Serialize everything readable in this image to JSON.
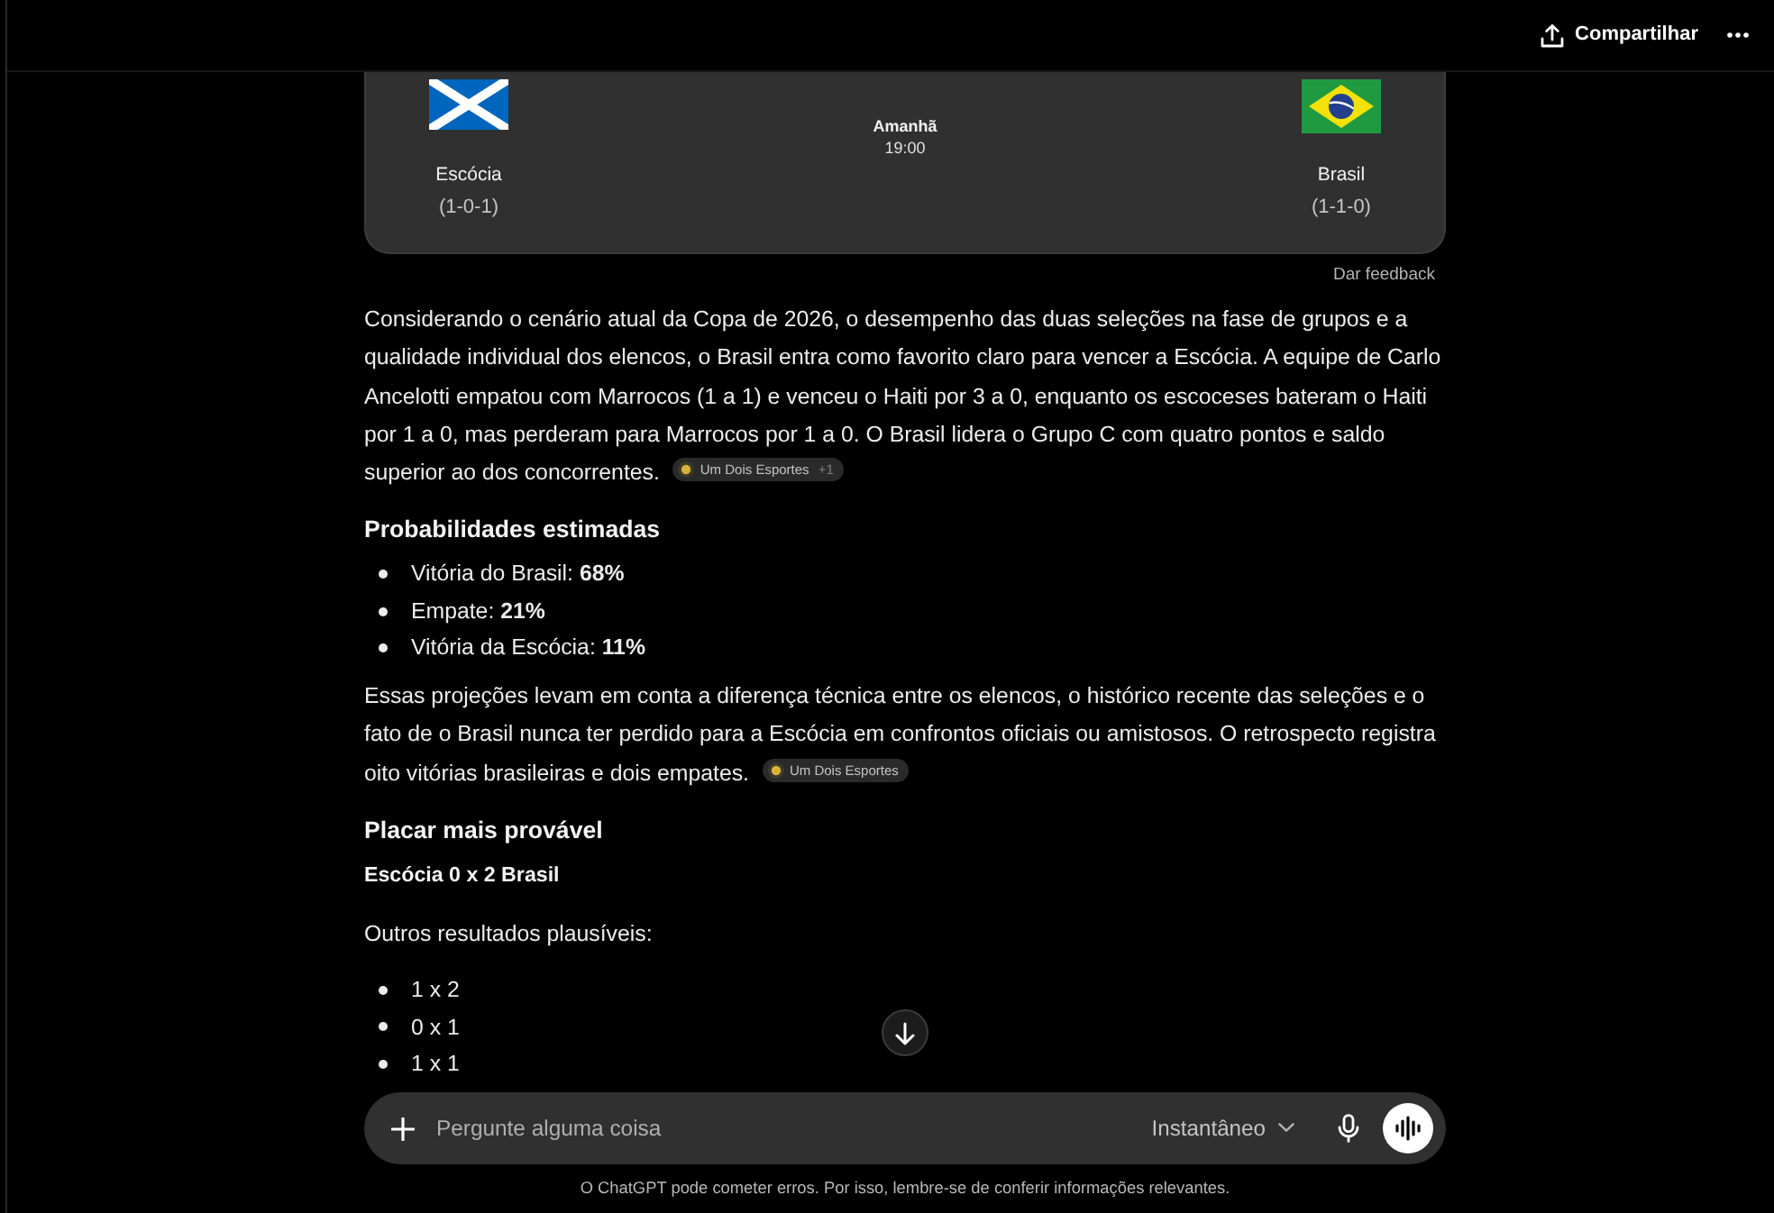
{
  "header": {
    "share_label": "Compartilhar"
  },
  "match_card": {
    "teams": [
      {
        "kind": "scotland",
        "name": "Escócia",
        "record": "(1-0-1)"
      },
      {
        "kind": "brazil",
        "name": "Brasil",
        "record": "(1-1-0)"
      }
    ],
    "kickoff": {
      "day": "Amanhã",
      "time": "19:00"
    },
    "feedback_label": "Dar feedback"
  },
  "response": [
    {
      "kind": "paragraph",
      "text": "Considerando o cenário atual da Copa de 2026, o desempenho das duas seleções na fase de grupos e a qualidade individual dos elencos, o Brasil entra como favorito claro para vencer a Escócia. A equipe de Carlo Ancelotti empatou com Marrocos (1 a 1) e venceu o Haiti por 3 a 0, enquanto os escoceses bateram o Haiti por 1 a 0, mas perderam para Marrocos por 1 a 0. O Brasil lidera o Grupo C com quatro pontos e saldo superior ao dos concorrentes.",
      "citations": [
        {
          "source": "Um Dois Esportes",
          "extra": "+1"
        }
      ]
    },
    {
      "kind": "heading",
      "text": "Probabilidades estimadas"
    },
    {
      "kind": "list",
      "items": [
        "Vitória do Brasil: **68%**",
        "Empate: **21%**",
        "Vitória da Escócia: **11%**"
      ]
    },
    {
      "kind": "paragraph",
      "text": "Essas projeções levam em conta a diferença técnica entre os elencos, o histórico recente das seleções e o fato de o Brasil nunca ter perdido para a Escócia em confrontos oficiais ou amistosos. O retrospecto registra oito vitórias brasileiras e dois empates.",
      "citations": [
        {
          "source": "Um Dois Esportes"
        }
      ]
    },
    {
      "kind": "heading",
      "text": "Placar mais provável"
    },
    {
      "kind": "strong",
      "text": "Escócia 0 x 2 Brasil"
    },
    {
      "kind": "paragraph",
      "text": "Outros resultados plausíveis:"
    },
    {
      "kind": "list",
      "items": [
        "1 x 2",
        "0 x 1",
        "1 x 1"
      ]
    }
  ],
  "composer": {
    "placeholder": "Pergunte alguma coisa",
    "model": "Instantâneo"
  },
  "disclaimer": "O ChatGPT pode cometer erros. Por isso, lembre-se de conferir informações relevantes."
}
